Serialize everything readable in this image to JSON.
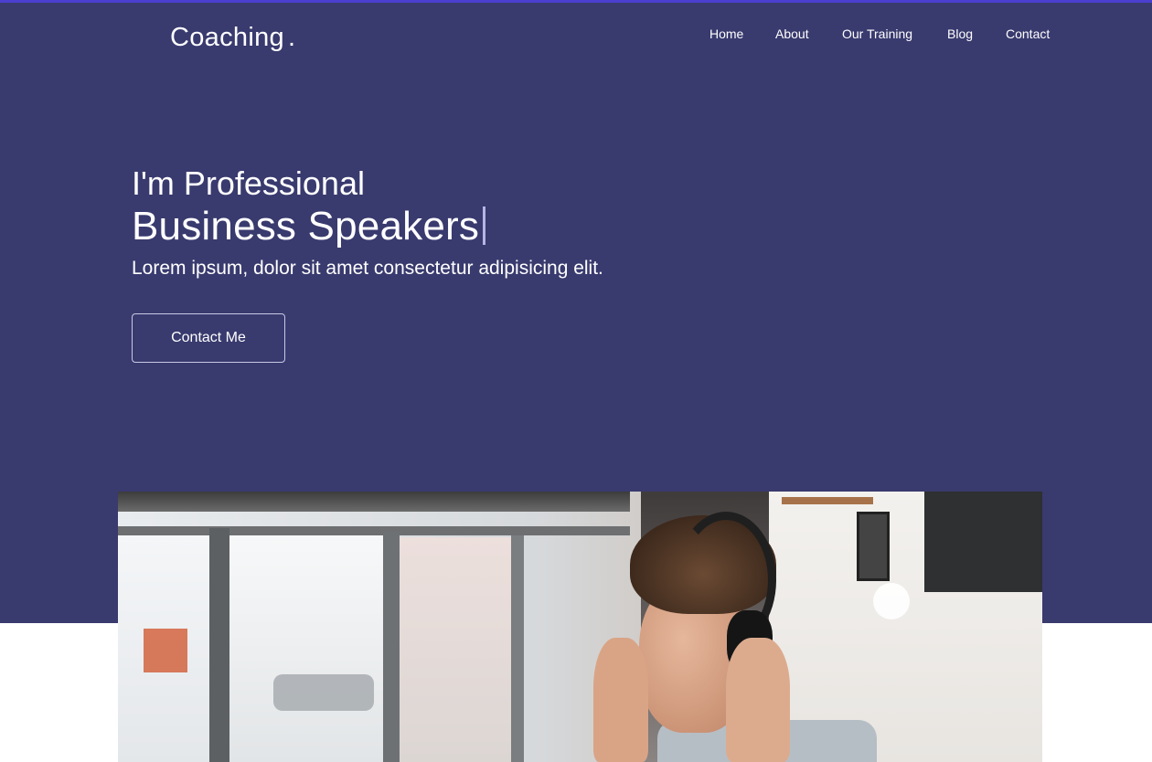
{
  "header": {
    "logo_text": "Coaching",
    "logo_dot": ".",
    "nav": [
      "Home",
      "About",
      "Our Training",
      "Blog",
      "Contact"
    ]
  },
  "hero": {
    "intro": "I'm Professional",
    "headline": "Business Speakers",
    "tagline": "Lorem ipsum, dolor sit amet consectetur adipisicing elit.",
    "cta_label": "Contact Me"
  },
  "colors": {
    "hero_bg": "#393a6e",
    "top_accent": "#4a3fcf",
    "text": "#ffffff",
    "cursor": "#b7b5e4"
  }
}
